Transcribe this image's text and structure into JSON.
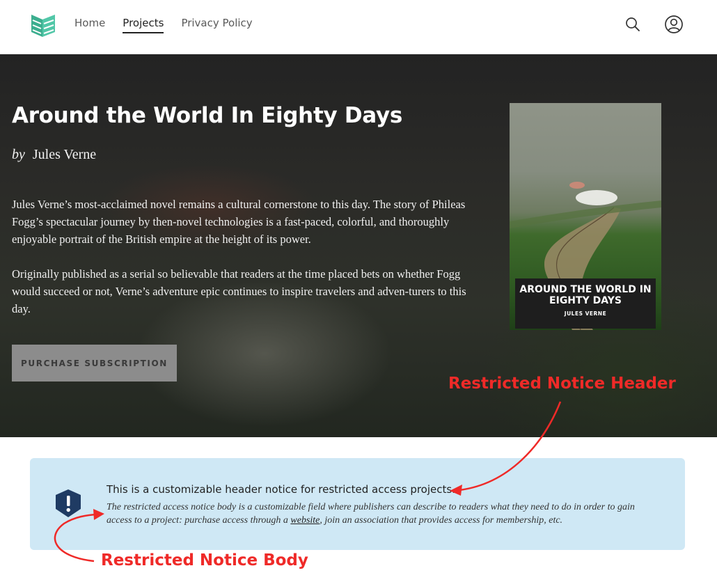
{
  "nav": {
    "logo_icon": "manifold-logo-icon",
    "items": [
      {
        "label": "Home",
        "active": false
      },
      {
        "label": "Projects",
        "active": true
      },
      {
        "label": "Privacy Policy",
        "active": false
      }
    ],
    "search_icon": "search-icon",
    "user_icon": "user-icon"
  },
  "hero": {
    "title": "Around the World In Eighty Days",
    "byline_prefix": "by",
    "author": "Jules Verne",
    "description_1": "Jules Verne’s most-acclaimed novel remains a cultural cornerstone to this day. The story of Phileas Fogg’s spectacular journey by then-novel technologies is a fast-paced, colorful, and thoroughly enjoyable portrait of the British empire at the height of its power.",
    "description_2": "Originally published as a serial so believable that readers at the time placed bets on whether Fogg would succeed or not, Verne’s adventure epic continues to inspire travelers and adven-turers to this day.",
    "purchase_label": "PURCHASE SUBSCRIPTION",
    "cover": {
      "title": "AROUND THE WORLD IN EIGHTY DAYS",
      "author": "JULES VERNE"
    }
  },
  "notice": {
    "icon": "exclamation-shield-icon",
    "header": "This is a customizable header notice for restricted access projects.",
    "body_before": "The restricted access notice body is a customizable field where publishers can describe to readers what they need to do in order to gain access to a project: purchase access through a ",
    "body_link": "website",
    "body_after": ", join an association that provides access for membership, etc."
  },
  "annotations": {
    "header_label": "Restricted Notice Header",
    "body_label": "Restricted Notice Body"
  },
  "colors": {
    "accent": "#52c7a8",
    "notice_bg": "#cfe8f5",
    "annotation": "#ef2a28",
    "icon_navy": "#1f3b63"
  }
}
